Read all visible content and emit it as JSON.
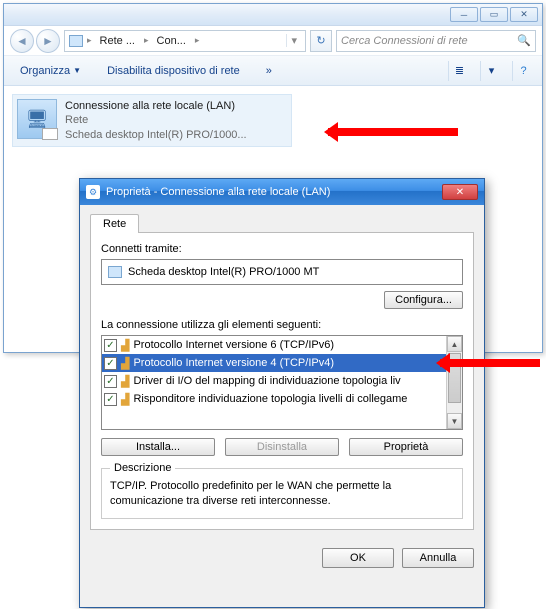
{
  "explorer": {
    "breadcrumbs": [
      "Rete ...",
      "Con..."
    ],
    "search_placeholder": "Cerca Connessioni di rete",
    "cmd_organize": "Organizza",
    "cmd_disable": "Disabilita dispositivo di rete",
    "chevrons": "»",
    "connection": {
      "title": "Connessione alla rete locale (LAN)",
      "status": "Rete",
      "adapter": "Scheda desktop Intel(R) PRO/1000..."
    }
  },
  "dialog": {
    "title": "Proprietà - Connessione alla rete locale (LAN)",
    "tab": "Rete",
    "connect_via_label": "Connetti tramite:",
    "adapter_name": "Scheda desktop Intel(R) PRO/1000 MT",
    "configure_btn": "Configura...",
    "uses_label": "La connessione utilizza gli elementi seguenti:",
    "items": [
      {
        "checked": true,
        "text": "Protocollo Internet versione 6 (TCP/IPv6)",
        "selected": false
      },
      {
        "checked": true,
        "text": "Protocollo Internet versione 4 (TCP/IPv4)",
        "selected": true
      },
      {
        "checked": true,
        "text": "Driver di I/O del mapping di individuazione topologia liv",
        "selected": false
      },
      {
        "checked": true,
        "text": "Risponditore individuazione topologia livelli di collegame",
        "selected": false
      }
    ],
    "install_btn": "Installa...",
    "uninstall_btn": "Disinstalla",
    "properties_btn": "Proprietà",
    "desc_label": "Descrizione",
    "desc_text": "TCP/IP. Protocollo predefinito per le WAN che permette la comunicazione tra diverse reti interconnesse.",
    "ok_btn": "OK",
    "cancel_btn": "Annulla"
  }
}
